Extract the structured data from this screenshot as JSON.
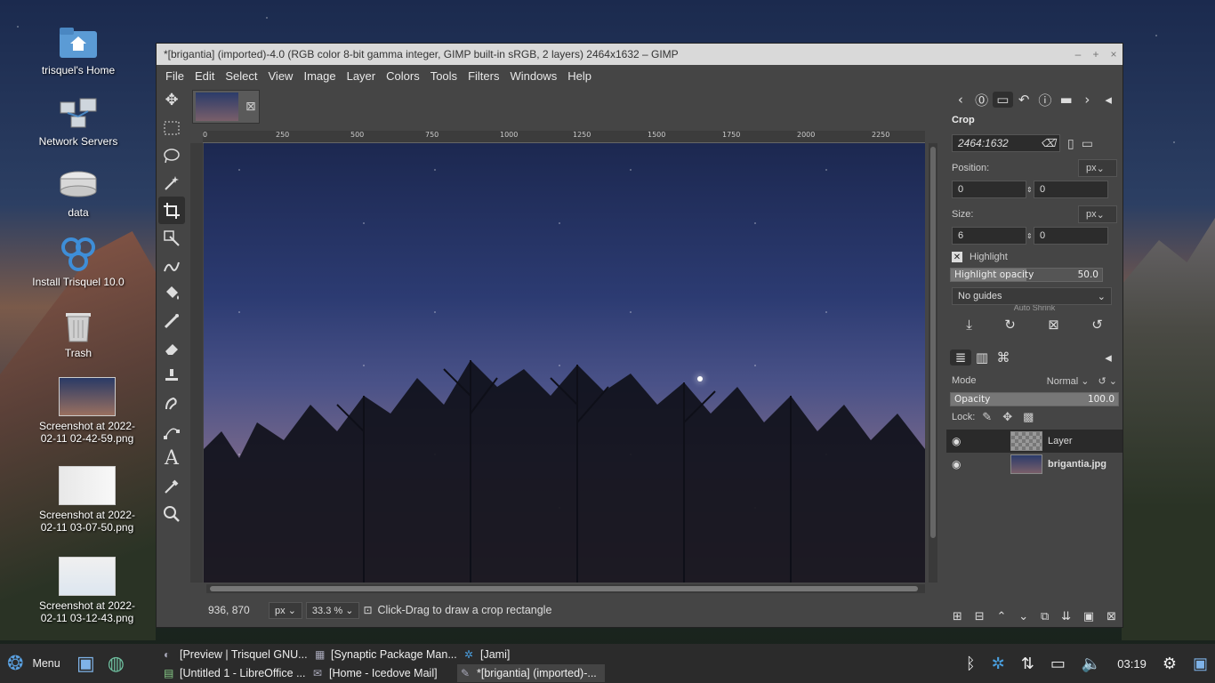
{
  "desktop": {
    "icons": [
      {
        "label": "trisquel's Home",
        "icon": "home-folder-icon"
      },
      {
        "label": "Network Servers",
        "icon": "network-icon"
      },
      {
        "label": "data",
        "icon": "drive-icon"
      },
      {
        "label": "Install Trisquel 10.0",
        "icon": "trisquel-icon"
      },
      {
        "label": "Trash",
        "icon": "trash-icon"
      },
      {
        "label": "Screenshot at 2022-02-11 02-42-59.png",
        "icon": "image-file-icon"
      },
      {
        "label": "Screenshot at 2022-02-11 03-07-50.png",
        "icon": "image-file-icon"
      },
      {
        "label": "Screenshot at 2022-02-11 03-12-43.png",
        "icon": "image-file-icon"
      }
    ]
  },
  "window": {
    "title": "*[brigantia] (imported)-4.0 (RGB color 8-bit gamma integer, GIMP built-in sRGB, 2 layers) 2464x1632 – GIMP",
    "controls": {
      "minimize": "–",
      "maximize": "+",
      "close": "×"
    }
  },
  "menubar": [
    "File",
    "Edit",
    "Select",
    "View",
    "Image",
    "Layer",
    "Colors",
    "Tools",
    "Filters",
    "Windows",
    "Help"
  ],
  "ruler": {
    "ticks": [
      "0",
      "250",
      "500",
      "750",
      "1000",
      "1250",
      "1500",
      "1750",
      "2000",
      "2250"
    ]
  },
  "statusbar": {
    "coords": "936, 870",
    "unit": "px",
    "zoom": "33.3 %",
    "message": "Click-Drag to draw a crop rectangle"
  },
  "tool_options": {
    "title": "Crop",
    "aspect_value": "2464:1632",
    "position_label": "Position:",
    "position_unit": "px",
    "position_x": "0",
    "position_y": "0",
    "size_label": "Size:",
    "size_unit": "px",
    "size_w": "6",
    "size_h": "0",
    "highlight_label": "Highlight",
    "highlight_opacity_label": "Highlight opacity",
    "highlight_opacity_value": "50.0",
    "highlight_opacity_fraction": 0.5,
    "guides": "No guides",
    "auto_shrink": "Auto Shrink"
  },
  "layers_panel": {
    "mode_label": "Mode",
    "mode_value": "Normal",
    "opacity_label": "Opacity",
    "opacity_value": "100.0",
    "lock_label": "Lock:",
    "layers": [
      {
        "name": "Layer",
        "selected": true
      },
      {
        "name": "brigantia.jpg",
        "selected": false
      }
    ]
  },
  "taskbar": {
    "menu_label": "Menu",
    "tasks": [
      {
        "label": "[Preview | Trisquel GNU...",
        "active": false
      },
      {
        "label": "[Synaptic Package Man...",
        "active": false
      },
      {
        "label": "[Jami]",
        "active": false
      },
      {
        "label": "[Untitled 1 - LibreOffice ...",
        "active": false
      },
      {
        "label": "[Home - Icedove Mail]",
        "active": false
      },
      {
        "label": "*[brigantia] (imported)-...",
        "active": true
      }
    ],
    "clock": "03:19"
  }
}
